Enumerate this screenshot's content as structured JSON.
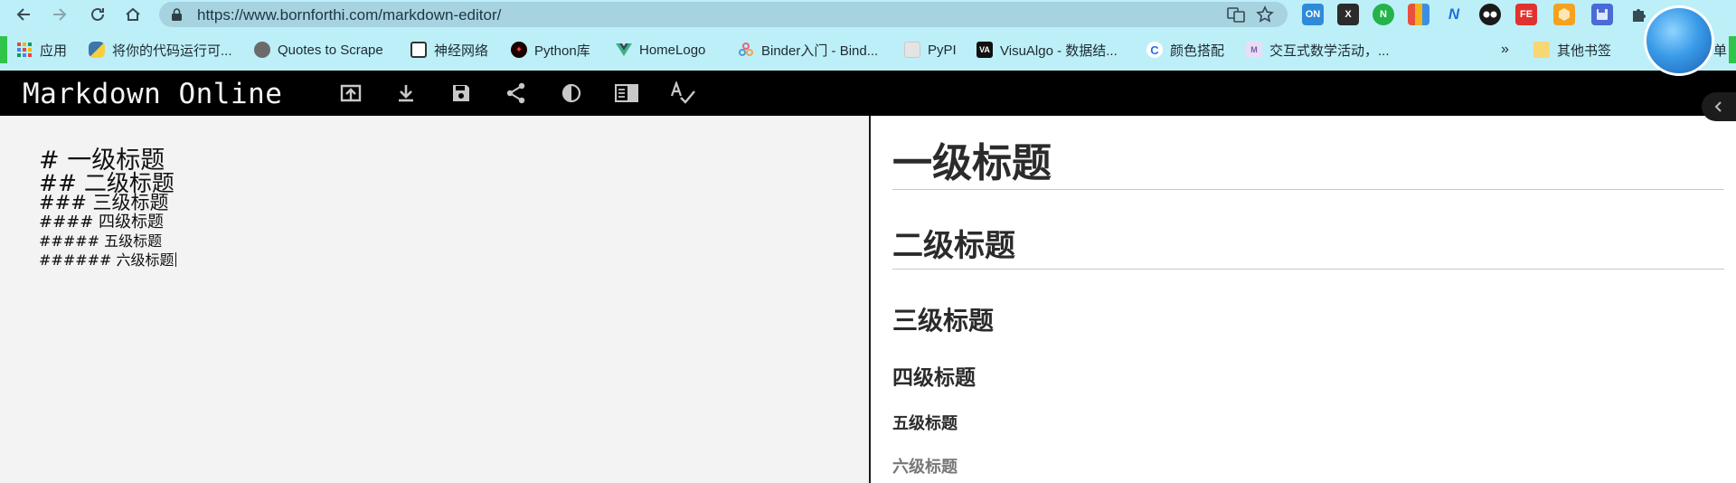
{
  "browser": {
    "url": "https://www.bornforthi.com/markdown-editor/",
    "nav": {
      "back_icon": "back-arrow-icon",
      "forward_icon": "forward-arrow-icon",
      "reload_icon": "reload-icon",
      "home_icon": "home-icon"
    },
    "omnibox_icons": [
      "translate-icon",
      "bookmark-star-icon"
    ],
    "extensions": [
      {
        "name": "on-extension",
        "label": "ON",
        "color": "#2f8bd8"
      },
      {
        "name": "x-extension",
        "label": "X",
        "color": "#2b2b2b"
      },
      {
        "name": "n-extension",
        "label": "N",
        "color": "#23b34a"
      },
      {
        "name": "grid-extension",
        "label": "",
        "color": "#e94f3d"
      },
      {
        "name": "n-script-extension",
        "label": "N",
        "color": "#1f6fe0"
      },
      {
        "name": "glasses-extension",
        "label": "",
        "color": "#1a1a1a"
      },
      {
        "name": "fe-extension",
        "label": "FE",
        "color": "#e0322f"
      },
      {
        "name": "hexagon-extension",
        "label": "",
        "color": "#f4a21f"
      },
      {
        "name": "save-extension",
        "label": "",
        "color": "#4a6bd6"
      },
      {
        "name": "puzzle-extension",
        "label": "",
        "color": "#354a52"
      }
    ],
    "bookmarks": [
      {
        "label": "应用",
        "icon": "apps-grid-icon",
        "color": "#e8453c"
      },
      {
        "label": "将你的代码运行可...",
        "icon": "python-icon",
        "color": "#3b77a8"
      },
      {
        "label": "Quotes to Scrape",
        "icon": "globe-icon",
        "color": "#6b6b6b"
      },
      {
        "label": "神经网络",
        "icon": "spiral-icon",
        "color": "#333333"
      },
      {
        "label": "Python库",
        "icon": "python-lib-icon",
        "color": "#c0151b"
      },
      {
        "label": "HomeLogo",
        "icon": "vue-icon",
        "color": "#3fb27f"
      },
      {
        "label": "Binder入门 - Bind...",
        "icon": "binder-icon",
        "color": "#e66581"
      },
      {
        "label": "PyPI",
        "icon": "pypi-icon",
        "color": "#c9c9c9"
      },
      {
        "label": "VisuAlgo - 数据结...",
        "icon": "visualgo-icon",
        "color": "#111111"
      },
      {
        "label": "颜色搭配",
        "icon": "color-icon",
        "color": "#1e73e8"
      },
      {
        "label": "交互式数学活动，...",
        "icon": "math-icon",
        "color": "#7a5aa8"
      }
    ],
    "bookmarks_overflow": "»",
    "other_bookmarks": "其他书签",
    "other_bookmarks_icon": "folder-icon",
    "overflow_tail": "单"
  },
  "app": {
    "title": "Markdown Online",
    "tools": [
      "upload-icon",
      "download-icon",
      "save-icon",
      "share-icon",
      "contrast-icon",
      "layout-icon",
      "spellcheck-icon"
    ],
    "collapse_icon": "chevron-left-icon"
  },
  "editor": {
    "lines": [
      "# 一级标题",
      "## 二级标题",
      "### 三级标题",
      "#### 四级标题",
      "##### 五级标题",
      "###### 六级标题"
    ]
  },
  "preview": {
    "h1": "一级标题",
    "h2": "二级标题",
    "h3": "三级标题",
    "h4": "四级标题",
    "h5": "五级标题",
    "h6": "六级标题"
  },
  "colors": {
    "chrome_bg": "#bdeff9",
    "omnibox_bg": "#a6d3df",
    "appbar_bg": "#000000",
    "editor_bg": "#f3f3f3",
    "preview_bg": "#ffffff"
  }
}
